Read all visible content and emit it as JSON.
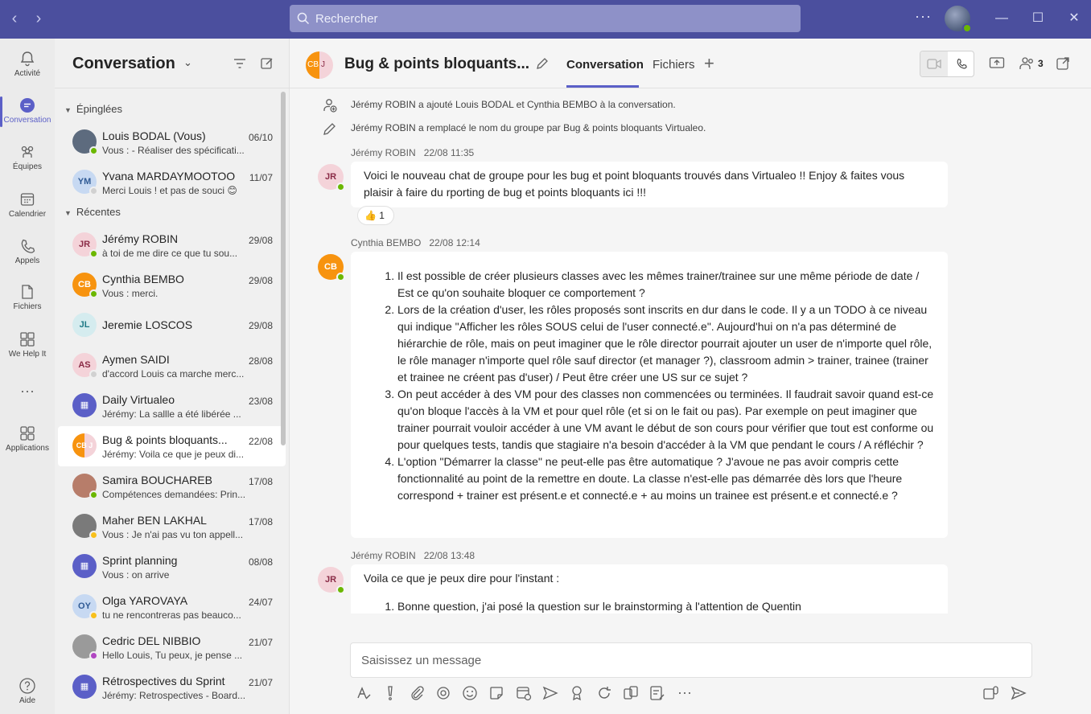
{
  "search": {
    "placeholder": "Rechercher"
  },
  "rail": {
    "items": [
      {
        "label": "Activité",
        "icon": "bell-icon"
      },
      {
        "label": "Conversation",
        "icon": "chat-icon",
        "active": true
      },
      {
        "label": "Équipes",
        "icon": "teams-icon"
      },
      {
        "label": "Calendrier",
        "icon": "calendar-icon"
      },
      {
        "label": "Appels",
        "icon": "phone-icon"
      },
      {
        "label": "Fichiers",
        "icon": "file-icon"
      },
      {
        "label": "We Help It",
        "icon": "app-icon"
      },
      {
        "label": "Applications",
        "icon": "apps-icon"
      },
      {
        "label": "Aide",
        "icon": "help-icon"
      }
    ]
  },
  "chatlist": {
    "title": "Conversation",
    "pinned_label": "Épinglées",
    "recent_label": "Récentes",
    "pinned": [
      {
        "name": "Louis BODAL (Vous)",
        "date": "06/10",
        "preview": "Vous : - Réaliser des spécificati...",
        "initials": "",
        "bg": "#5d6b7e",
        "fg": "#fff",
        "status": "#6bb700"
      },
      {
        "name": "Yvana MARDAYMOOTOO",
        "date": "11/07",
        "preview": "Merci Louis ! et pas de souci 😊",
        "initials": "YM",
        "bg": "#c7d9f2",
        "fg": "#2f5a94",
        "status": "#d1d1d1"
      }
    ],
    "recent": [
      {
        "name": "Jérémy ROBIN",
        "date": "29/08",
        "preview": "à toi de me dire ce que tu sou...",
        "initials": "JR",
        "bg": "#f4d3d9",
        "fg": "#8a2b46",
        "status": "#6bb700"
      },
      {
        "name": "Cynthia BEMBO",
        "date": "29/08",
        "preview": "Vous : merci.",
        "initials": "CB",
        "bg": "#f7930f",
        "fg": "#fff",
        "status": "#6bb700"
      },
      {
        "name": "Jeremie LOSCOS",
        "date": "29/08",
        "preview": "",
        "initials": "JL",
        "bg": "#d5ecef",
        "fg": "#1f7a86",
        "status": ""
      },
      {
        "name": "Aymen SAIDI",
        "date": "28/08",
        "preview": "d'accord Louis ca marche merc...",
        "initials": "AS",
        "bg": "#f4d3d9",
        "fg": "#8a2b46",
        "status": "#d1d1d1"
      },
      {
        "name": "Daily Virtualeo",
        "date": "23/08",
        "preview": "Jérémy: La sallle a été libérée ...",
        "initials": "▦",
        "bg": "#5b5fc7",
        "fg": "#fff",
        "status": ""
      },
      {
        "name": "Bug & points bloquants...",
        "date": "22/08",
        "preview": "Jérémy: Voila ce que je peux di...",
        "initials": "CB J",
        "bg": "#f7930f",
        "fg": "#fff",
        "status": "",
        "selected": true
      },
      {
        "name": "Samira BOUCHAREB",
        "date": "17/08",
        "preview": "Compétences demandées: Prin...",
        "initials": "",
        "bg": "#b77d6a",
        "fg": "#fff",
        "status": "#6bb700"
      },
      {
        "name": "Maher BEN LAKHAL",
        "date": "17/08",
        "preview": "Vous : Je n'ai pas vu ton appell...",
        "initials": "",
        "bg": "#7a7a7a",
        "fg": "#fff",
        "status": "#f8c01b"
      },
      {
        "name": "Sprint planning",
        "date": "08/08",
        "preview": "Vous : on arrive",
        "initials": "▦",
        "bg": "#5b5fc7",
        "fg": "#fff",
        "status": ""
      },
      {
        "name": "Olga YAROVAYA",
        "date": "24/07",
        "preview": "tu ne rencontreras pas beauco...",
        "initials": "OY",
        "bg": "#c7d9f2",
        "fg": "#2f5a94",
        "status": "#f8c01b"
      },
      {
        "name": "Cedric DEL NIBBIO",
        "date": "21/07",
        "preview": "Hello Louis, Tu peux, je pense ...",
        "initials": "",
        "bg": "#9a9a9a",
        "fg": "#fff",
        "status": "#b146c2"
      },
      {
        "name": "Rétrospectives du Sprint",
        "date": "21/07",
        "preview": "Jérémy: Retrospectives - Board...",
        "initials": "▦",
        "bg": "#5b5fc7",
        "fg": "#fff",
        "status": ""
      }
    ]
  },
  "channel": {
    "title": "Bug & points bloquants...",
    "tabs": [
      "Conversation",
      "Fichiers"
    ],
    "participants_count": "3"
  },
  "messages": {
    "system": [
      "Jérémy ROBIN a ajouté Louis BODAL et Cynthia BEMBO à la conversation.",
      "Jérémy ROBIN a remplacé le nom du groupe par Bug & points bloquants Virtualeo."
    ],
    "m1": {
      "author": "Jérémy ROBIN",
      "time": "22/08 11:35",
      "initials": "JR",
      "text": "Voici le nouveau chat de groupe pour les bug et point bloquants trouvés dans Virtualeo !! Enjoy & faites vous plaisir à faire du rporting de bug et points bloquants ici !!!",
      "reaction_emoji": "👍",
      "reaction_count": "1"
    },
    "m2": {
      "author": "Cynthia BEMBO",
      "time": "22/08 12:14",
      "initials": "CB",
      "items": [
        "Il est possible de créer plusieurs classes avec les mêmes trainer/trainee sur une même période de date / Est ce qu'on souhaite bloquer ce comportement ?",
        "Lors de la création d'user, les rôles proposés sont inscrits en dur dans le code. Il y a un TODO à ce niveau qui indique \"Afficher les rôles SOUS celui de l'user connecté.e\". Aujourd'hui on n'a pas déterminé de hiérarchie de rôle, mais on peut imaginer que le rôle director pourrait ajouter un user de n'importe quel rôle, le rôle manager n'importe quel rôle sauf director (et manager ?), classroom admin > trainer, trainee (trainer et trainee ne créent pas d'user) / Peut être créer une US sur ce sujet ?",
        "On peut accéder à des VM pour des classes non commencées ou terminées. Il faudrait savoir quand est-ce qu'on bloque l'accès à la VM et pour quel rôle (et si on le fait ou pas). Par exemple on peut imaginer que trainer pourrait vouloir accéder à une VM avant le début de son cours pour vérifier que tout est conforme ou pour quelques tests, tandis que stagiaire n'a besoin d'accéder à la VM que pendant le cours / A réfléchir ?",
        "L'option \"Démarrer la classe\" ne peut-elle pas être automatique ? J'avoue ne pas avoir compris cette fonctionnalité au point de la remettre en doute. La classe n'est-elle pas démarrée dès lors que l'heure correspond + trainer est présent.e et connecté.e + au moins un trainee est présent.e et connecté.e ?"
      ]
    },
    "m3": {
      "author": "Jérémy ROBIN",
      "time": "22/08 13:48",
      "initials": "JR",
      "text": "Voila ce que je peux dire pour l'instant :",
      "items": [
        "Bonne question, j'ai posé la question sur le brainstorming à l'attention de Quentin"
      ]
    }
  },
  "compose": {
    "placeholder": "Saisissez un message"
  }
}
